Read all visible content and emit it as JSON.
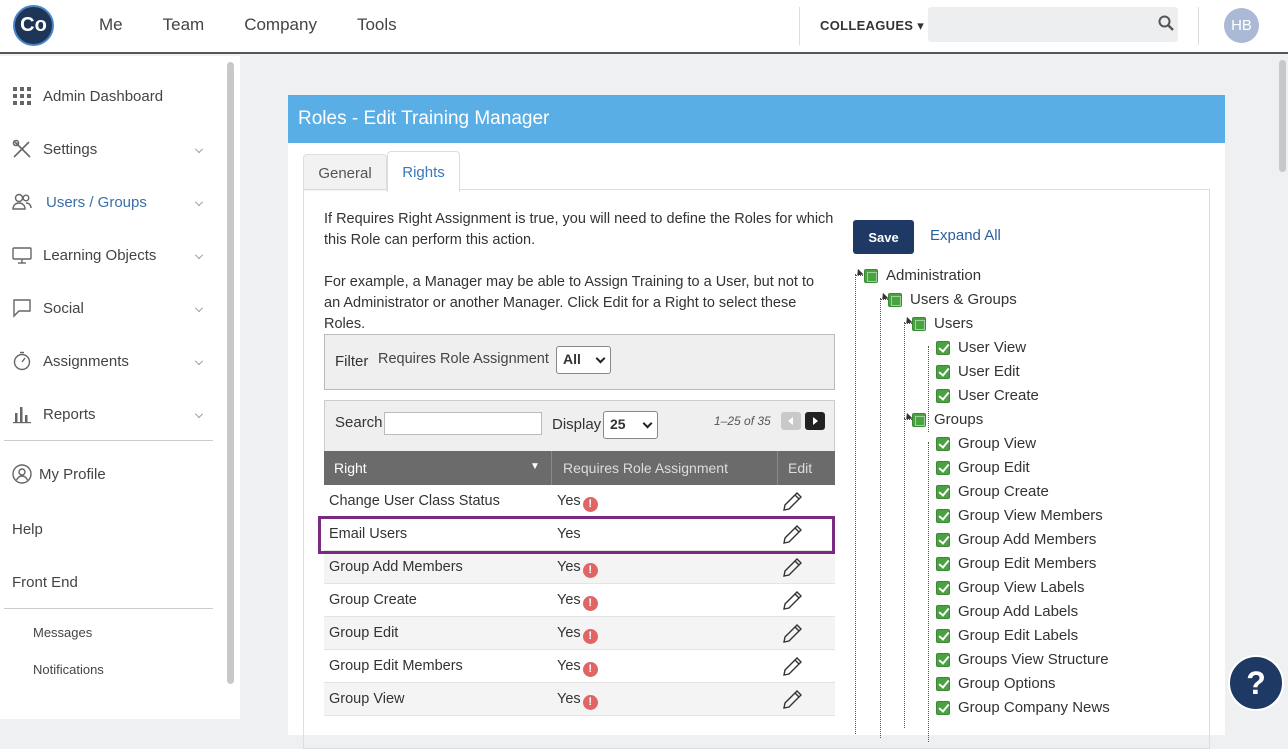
{
  "topbar": {
    "logo_text": "Co",
    "nav": [
      "Me",
      "Team",
      "Company",
      "Tools"
    ],
    "colleagues_label": "COLLEAGUES",
    "search_placeholder": "",
    "avatar_initials": "HB"
  },
  "sidebar": {
    "items": [
      {
        "label": "Admin Dashboard",
        "icon": "grid-icon"
      },
      {
        "label": "Settings",
        "icon": "tools-icon"
      },
      {
        "label": "Users / Groups",
        "icon": "users-icon"
      },
      {
        "label": "Learning Objects",
        "icon": "monitor-icon"
      },
      {
        "label": "Social",
        "icon": "chat-icon"
      },
      {
        "label": "Assignments",
        "icon": "stopwatch-icon"
      },
      {
        "label": "Reports",
        "icon": "bar-chart-icon"
      }
    ],
    "profile": "My Profile",
    "help": "Help",
    "front_end": "Front End",
    "messages": "Messages",
    "notifications": "Notifications"
  },
  "panel": {
    "title": "Roles - Edit Training Manager",
    "tabs": [
      "General",
      "Rights"
    ],
    "intro1": "If Requires Right Assignment is true, you will need to define the Roles for which this Role can perform this action.",
    "intro2": "For example, a Manager may be able to Assign Training to a User, but not to an Administrator or another Manager. Click Edit for a Right to select these Roles.",
    "filter_label": "Filter",
    "filter_field": "Requires Role Assignment",
    "filter_value": "All",
    "search_label": "Search",
    "display_label": "Display",
    "display_value": "25",
    "pager_text": "1–25 of 35",
    "columns": [
      "Right",
      "Requires Role Assignment",
      "Edit"
    ],
    "rows": [
      {
        "right": "Change User Class Status",
        "requires": "Yes",
        "warn": true
      },
      {
        "right": "Email Users",
        "requires": "Yes",
        "warn": false
      },
      {
        "right": "Group Add Members",
        "requires": "Yes",
        "warn": true
      },
      {
        "right": "Group Create",
        "requires": "Yes",
        "warn": true
      },
      {
        "right": "Group Edit",
        "requires": "Yes",
        "warn": true
      },
      {
        "right": "Group Edit Members",
        "requires": "Yes",
        "warn": true
      },
      {
        "right": "Group View",
        "requires": "Yes",
        "warn": true
      }
    ],
    "save_label": "Save",
    "expand_label": "Expand All",
    "warn_glyph": "!"
  },
  "tree": {
    "administration": "Administration",
    "users_groups": "Users & Groups",
    "users": "Users",
    "user_items": [
      "User View",
      "User Edit",
      "User Create"
    ],
    "groups": "Groups",
    "group_items": [
      "Group View",
      "Group Edit",
      "Group Create",
      "Group View Members",
      "Group Add Members",
      "Group Edit Members",
      "Group View Labels",
      "Group Add Labels",
      "Group Edit Labels",
      "Groups View Structure",
      "Group Options",
      "Group Company News"
    ]
  },
  "help_glyph": "?",
  "colors": {
    "header_blue": "#5aaee6",
    "save_navy": "#1e3a64",
    "highlight_purple": "#7b2a84",
    "check_green": "#49a142"
  }
}
